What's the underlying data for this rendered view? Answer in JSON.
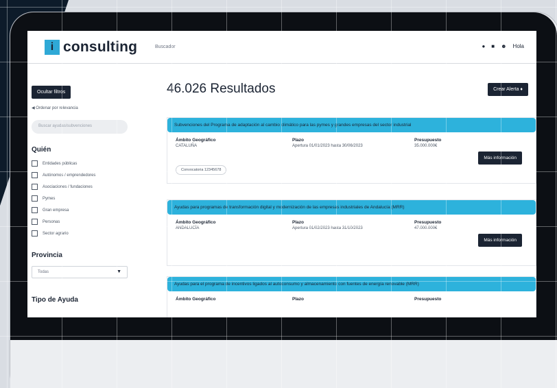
{
  "header": {
    "logo_mark": "i",
    "logo_text": "consulting",
    "nav_link": "Buscador",
    "icons": [
      "bell-icon",
      "mail-icon",
      "user-icon"
    ],
    "user_label": "Hola"
  },
  "sidebar": {
    "filter_button": "Ocultar filtros",
    "sort_label": "Ordenar por relevancia",
    "search_placeholder": "Buscar ayudas/subvenciones",
    "section_quien": "Quién",
    "quien_items": [
      "Entidades públicas",
      "Autónomos / emprendedores",
      "Asociaciones / fundaciones",
      "Pymes",
      "Gran empresa",
      "Personas",
      "Sector agrario"
    ],
    "section_province": "Provincia",
    "province_value": "Todas",
    "section_tipo": "Tipo de Ayuda"
  },
  "main": {
    "results_title": "46.026 Resultados",
    "create_alert_button": "Crear Alerta",
    "labels": {
      "ambito": "Ámbito Geográfico",
      "plazo": "Plazo",
      "presupuesto": "Presupuesto"
    },
    "more_button": "Más información",
    "cards": [
      {
        "title": "Subvenciones del Programa de adaptación al cambio climático para las pymes y grandes empresas del sector industrial",
        "ambito": "CATALUÑA",
        "plazo": "Apertura 01/01/2023 hasta 30/06/2023",
        "presupuesto": "35.000.000€",
        "tag": "Convocatoria 12345678"
      },
      {
        "title": "Ayudas para programas de transformación digital y modernización de las empresas industriales de Andalucía (MRR)",
        "ambito": "ANDALUCÍA",
        "plazo": "Apertura 01/02/2023 hasta 31/10/2023",
        "presupuesto": "47.000.000€",
        "tag": ""
      },
      {
        "title": "Ayudas para el programa de incentivos ligados al autoconsumo y almacenamiento con fuentes de energía renovable (MRR)",
        "ambito": "",
        "plazo": "",
        "presupuesto": "",
        "tag": ""
      }
    ]
  },
  "colors": {
    "accent": "#2db2dc",
    "dark": "#1b2433",
    "bezel": "#0c0f14",
    "background": "#0d1b2a"
  }
}
